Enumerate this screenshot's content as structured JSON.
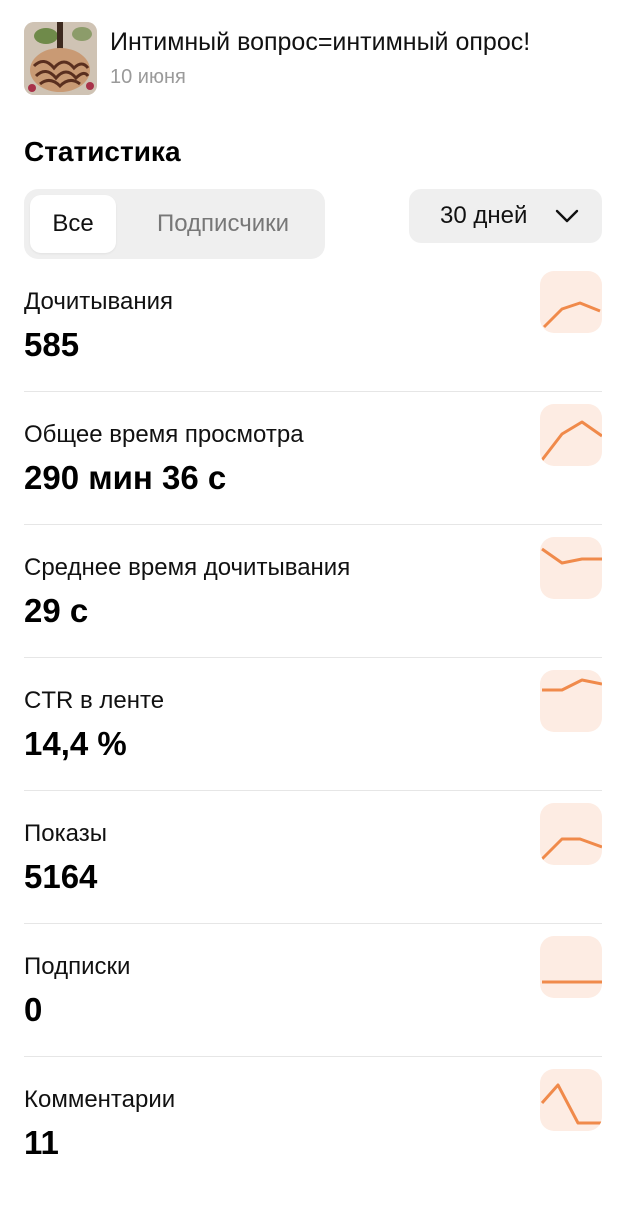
{
  "post": {
    "title": "Интимный вопрос=интимный опрос!",
    "date": "10 июня"
  },
  "stats": {
    "title": "Статистика",
    "tabs": [
      {
        "label": "Все",
        "active": true
      },
      {
        "label": "Подписчики",
        "active": false
      }
    ],
    "period": "30 дней"
  },
  "metrics": [
    {
      "label": "Дочитывания",
      "value": "585"
    },
    {
      "label": "Общее время просмотра",
      "value": "290 мин 36 с"
    },
    {
      "label": "Среднее время дочитывания",
      "value": "29 с"
    },
    {
      "label": "CTR в ленте",
      "value": "14,4 %"
    },
    {
      "label": "Показы",
      "value": "5164"
    },
    {
      "label": "Подписки",
      "value": "0"
    },
    {
      "label": "Комментарии",
      "value": "11"
    }
  ],
  "colors": {
    "accent": "#f08a4b",
    "spark_bg": "#fdece3",
    "control_bg": "#efefef",
    "muted_text": "#9a9a9a"
  },
  "icons": {
    "period_dropdown": "chevron-down-icon"
  }
}
